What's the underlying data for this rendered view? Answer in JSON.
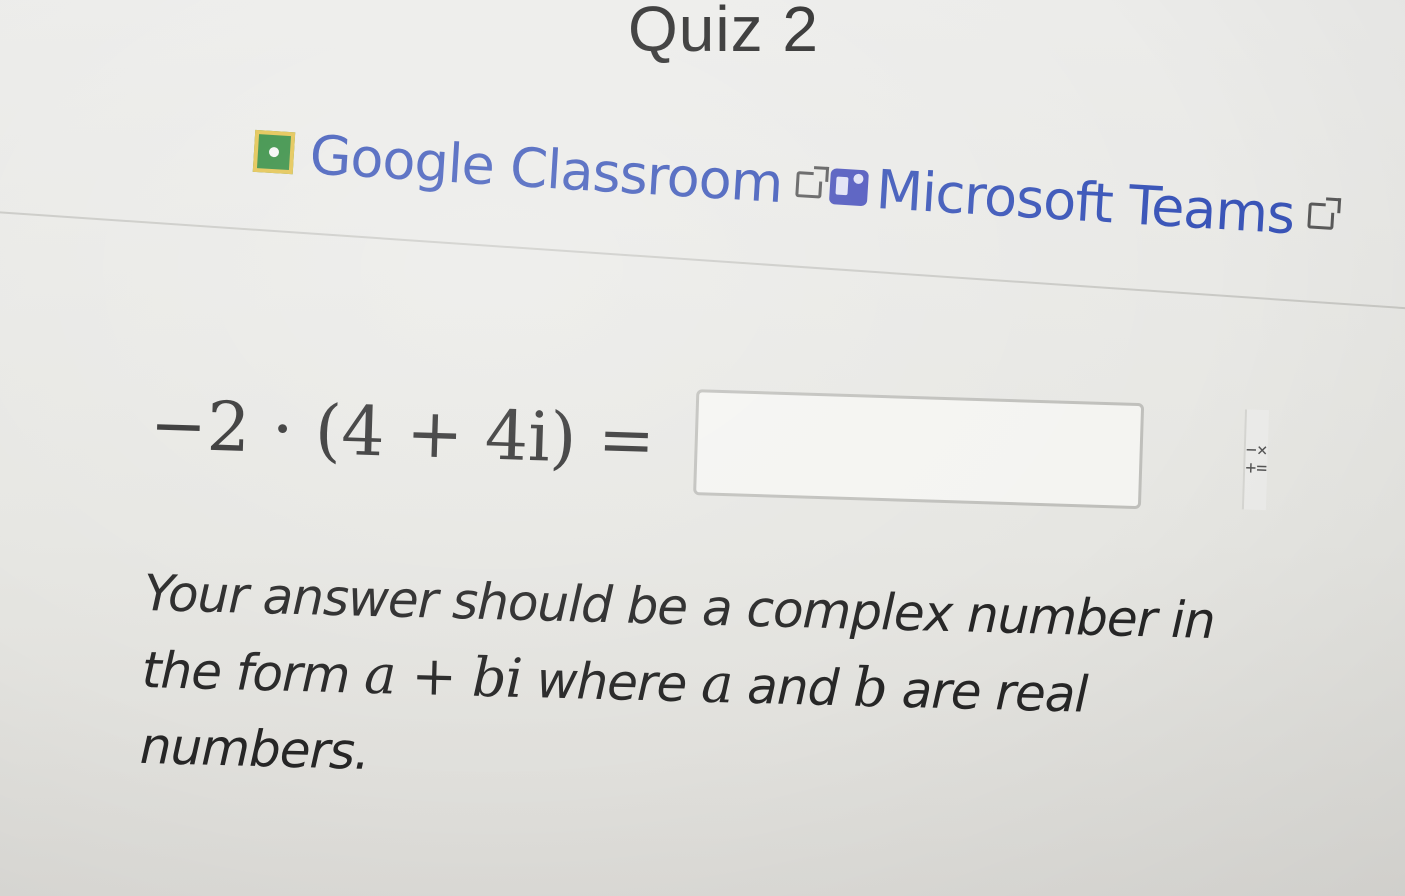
{
  "quiz": {
    "title": "Quiz 2"
  },
  "share_links": {
    "google_classroom": {
      "label": "Google Classroom",
      "icon": "google-classroom-icon",
      "external_icon": "external-link-icon"
    },
    "microsoft_teams": {
      "label": "Microsoft Teams",
      "icon": "microsoft-teams-icon",
      "external_icon": "external-link-icon"
    }
  },
  "question": {
    "expression": "−2 · (4 + 4i) =",
    "answer_value": "",
    "keypad_toggle_top": "−×",
    "keypad_toggle_bottom": "+="
  },
  "instructions": {
    "part1": "Your answer should be a complex number in the form ",
    "math1": "a + bi",
    "part2": " where ",
    "math2": "a",
    "part3": " and ",
    "math3": "b",
    "part4": " are real numbers."
  },
  "colors": {
    "link": "#3a55b8",
    "google_green": "#2f8a3c",
    "teams_purple": "#4b53bc",
    "text": "#262626"
  }
}
